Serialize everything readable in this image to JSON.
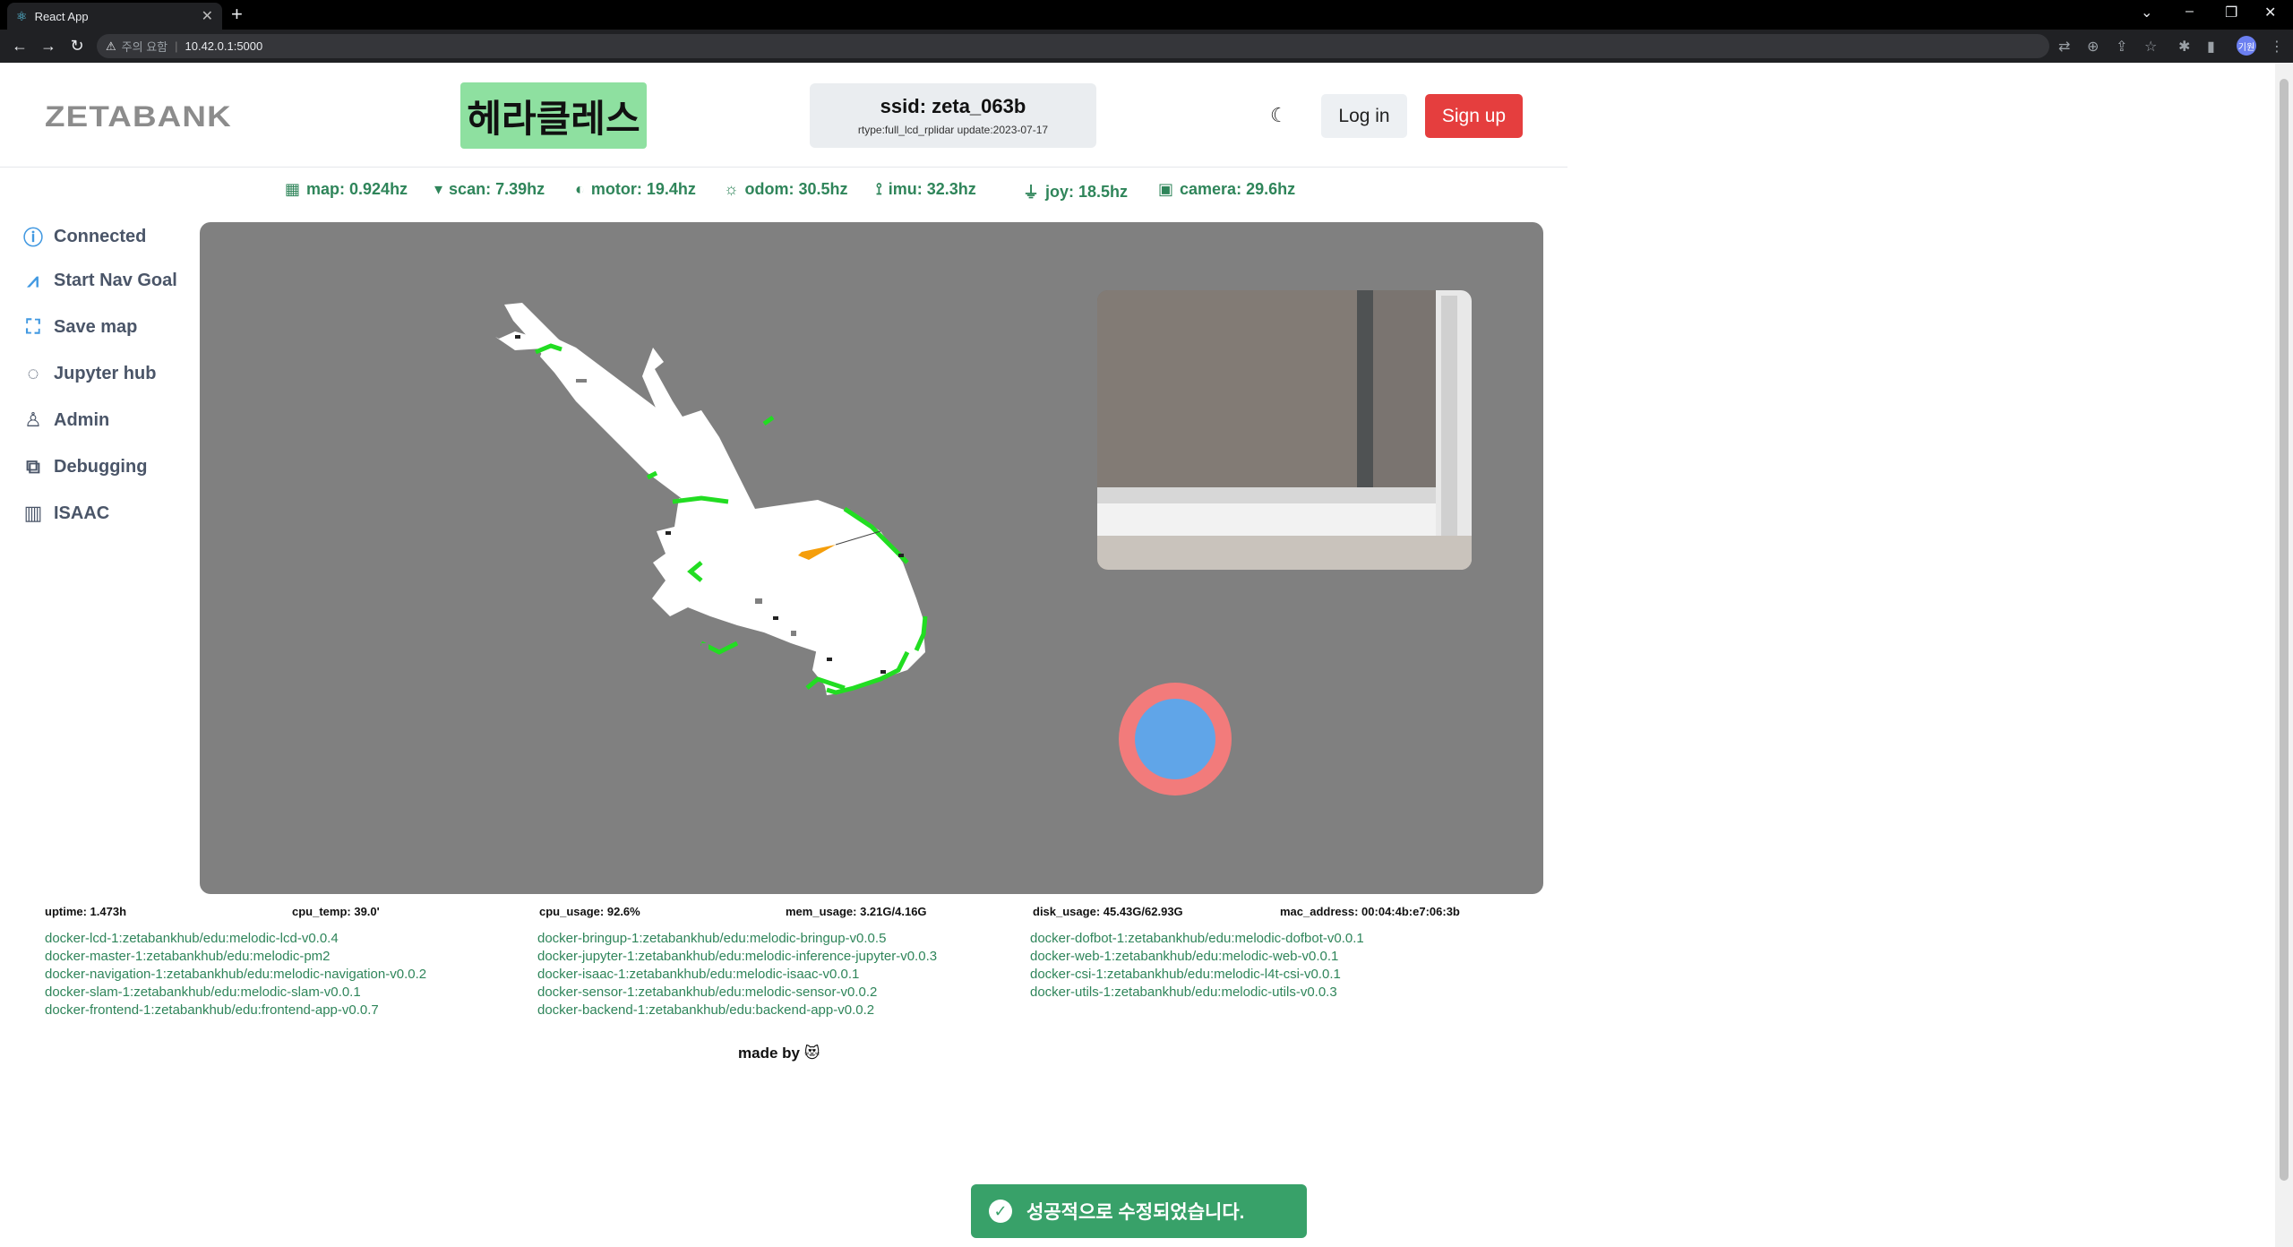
{
  "browser": {
    "tab_title": "React App",
    "url_warning": "주의 요함",
    "url": "10.42.0.1:5000",
    "profile_initials": "기원"
  },
  "header": {
    "logo": "ZETABANK",
    "robot_name": "헤라클레스",
    "ssid": "ssid: zeta_063b",
    "rtype": "rtype:full_lcd_rplidar update:2023-07-17",
    "login_label": "Log in",
    "signup_label": "Sign up"
  },
  "rates": [
    {
      "icon": "grid-icon",
      "label": "map: 0.924hz"
    },
    {
      "icon": "wifi-icon",
      "label": "scan: 7.39hz"
    },
    {
      "icon": "motor-icon",
      "label": "motor: 19.4hz"
    },
    {
      "icon": "sun-icon",
      "label": "odom: 30.5hz"
    },
    {
      "icon": "imu-icon",
      "label": "imu: 32.3hz"
    },
    {
      "icon": "joystick-icon",
      "label": "joy: 18.5hz"
    },
    {
      "icon": "camera-icon",
      "label": "camera: 29.6hz"
    }
  ],
  "sidebar": {
    "items": [
      {
        "icon": "connected-icon",
        "label": "Connected"
      },
      {
        "icon": "nav-goal-icon",
        "label": "Start Nav Goal"
      },
      {
        "icon": "map-icon",
        "label": "Save map"
      },
      {
        "icon": "jupyter-icon",
        "label": "Jupyter hub"
      },
      {
        "icon": "admin-icon",
        "label": "Admin"
      },
      {
        "icon": "debug-icon",
        "label": "Debugging"
      },
      {
        "icon": "chart-icon",
        "label": "ISAAC"
      }
    ]
  },
  "stats": {
    "uptime": "uptime: 1.473h",
    "cpu_temp": "cpu_temp: 39.0'",
    "cpu_usage": "cpu_usage: 92.6%",
    "mem_usage": "mem_usage: 3.21G/4.16G",
    "disk_usage": "disk_usage: 45.43G/62.93G",
    "mac_address": "mac_address: 00:04:4b:e7:06:3b"
  },
  "dockers": {
    "col1": [
      "docker-lcd-1:zetabankhub/edu:melodic-lcd-v0.0.4",
      "docker-master-1:zetabankhub/edu:melodic-pm2",
      "docker-navigation-1:zetabankhub/edu:melodic-navigation-v0.0.2",
      "docker-slam-1:zetabankhub/edu:melodic-slam-v0.0.1",
      "docker-frontend-1:zetabankhub/edu:frontend-app-v0.0.7"
    ],
    "col2": [
      "docker-bringup-1:zetabankhub/edu:melodic-bringup-v0.0.5",
      "docker-jupyter-1:zetabankhub/edu:melodic-inference-jupyter-v0.0.3",
      "docker-isaac-1:zetabankhub/edu:melodic-isaac-v0.0.1",
      "docker-sensor-1:zetabankhub/edu:melodic-sensor-v0.0.2",
      "docker-backend-1:zetabankhub/edu:backend-app-v0.0.2"
    ],
    "col3": [
      "docker-dofbot-1:zetabankhub/edu:melodic-dofbot-v0.0.1",
      "docker-web-1:zetabankhub/edu:melodic-web-v0.0.1",
      "docker-csi-1:zetabankhub/edu:melodic-l4t-csi-v0.0.1",
      "docker-utils-1:zetabankhub/edu:melodic-utils-v0.0.3"
    ]
  },
  "footer": {
    "made_by": "made by",
    "emoji": "😻"
  },
  "toast": {
    "message": "성공적으로 수정되었습니다."
  },
  "colors": {
    "accent_green": "#2f855a",
    "signup_red": "#e53e3e",
    "robot_name_bg": "#8ee0a0",
    "map_bg": "#808080",
    "toast_bg": "#38a169"
  }
}
